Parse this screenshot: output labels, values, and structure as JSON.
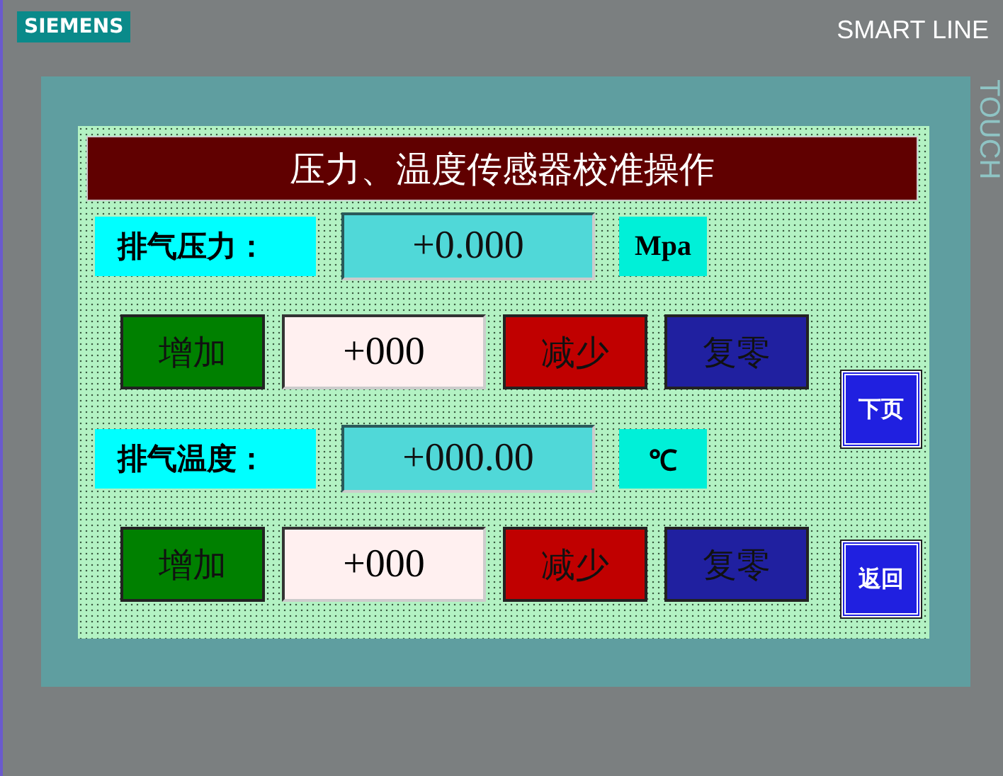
{
  "device": {
    "brand": "SIEMENS",
    "model": "SMART LINE",
    "side_label": "TOUCH"
  },
  "title": "压力、温度传感器校准操作",
  "sections": [
    {
      "label": "排气压力：",
      "value": "+0.000",
      "unit": "Mpa",
      "setpoint": "+000",
      "buttons": [
        {
          "label": "增加",
          "kind": "increase"
        },
        {
          "label": "减少",
          "kind": "decrease"
        },
        {
          "label": "复零",
          "kind": "reset"
        }
      ]
    },
    {
      "label": "排气温度：",
      "value": "+000.00",
      "unit": "℃",
      "setpoint": "+000",
      "buttons": [
        {
          "label": "增加",
          "kind": "increase"
        },
        {
          "label": "减少",
          "kind": "decrease"
        },
        {
          "label": "复零",
          "kind": "reset"
        }
      ]
    }
  ],
  "nav": [
    {
      "label": "下页"
    },
    {
      "label": "返回"
    }
  ]
}
